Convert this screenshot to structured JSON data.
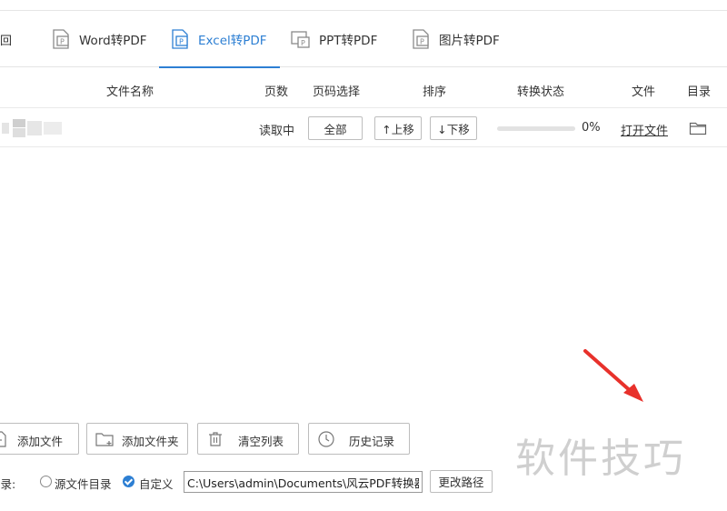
{
  "toolbar": {
    "back_label": "返回",
    "tabs": [
      {
        "label": "Word转PDF",
        "icon": "word-file-icon"
      },
      {
        "label": "Excel转PDF",
        "icon": "excel-file-icon",
        "active": true
      },
      {
        "label": "PPT转PDF",
        "icon": "ppt-file-icon"
      },
      {
        "label": "图片转PDF",
        "icon": "image-file-icon"
      }
    ]
  },
  "table": {
    "headers": [
      "文件名称",
      "页数",
      "页码选择",
      "排序",
      "转换状态",
      "文件",
      "目录"
    ],
    "rows": [
      {
        "pages": "读取中",
        "page_select": "全部",
        "move_up": "↑上移",
        "move_down": "↓下移",
        "progress": 0,
        "progress_text": "0%",
        "open_file": "打开文件",
        "dir_icon": "folder-icon"
      }
    ]
  },
  "actions": {
    "add_file": "添加文件",
    "add_folder": "添加文件夹",
    "clear_list": "清空列表",
    "history": "历史记录"
  },
  "output": {
    "label": "目录:",
    "option_source": "源文件目录",
    "option_custom": "自定义",
    "selected": "custom",
    "path": "C:\\Users\\admin\\Documents\\风云PDF转换器\\",
    "change_path": "更改路径"
  },
  "watermark": "软件技巧",
  "colors": {
    "accent": "#2d7fd3",
    "arrow": "#e8312b"
  }
}
